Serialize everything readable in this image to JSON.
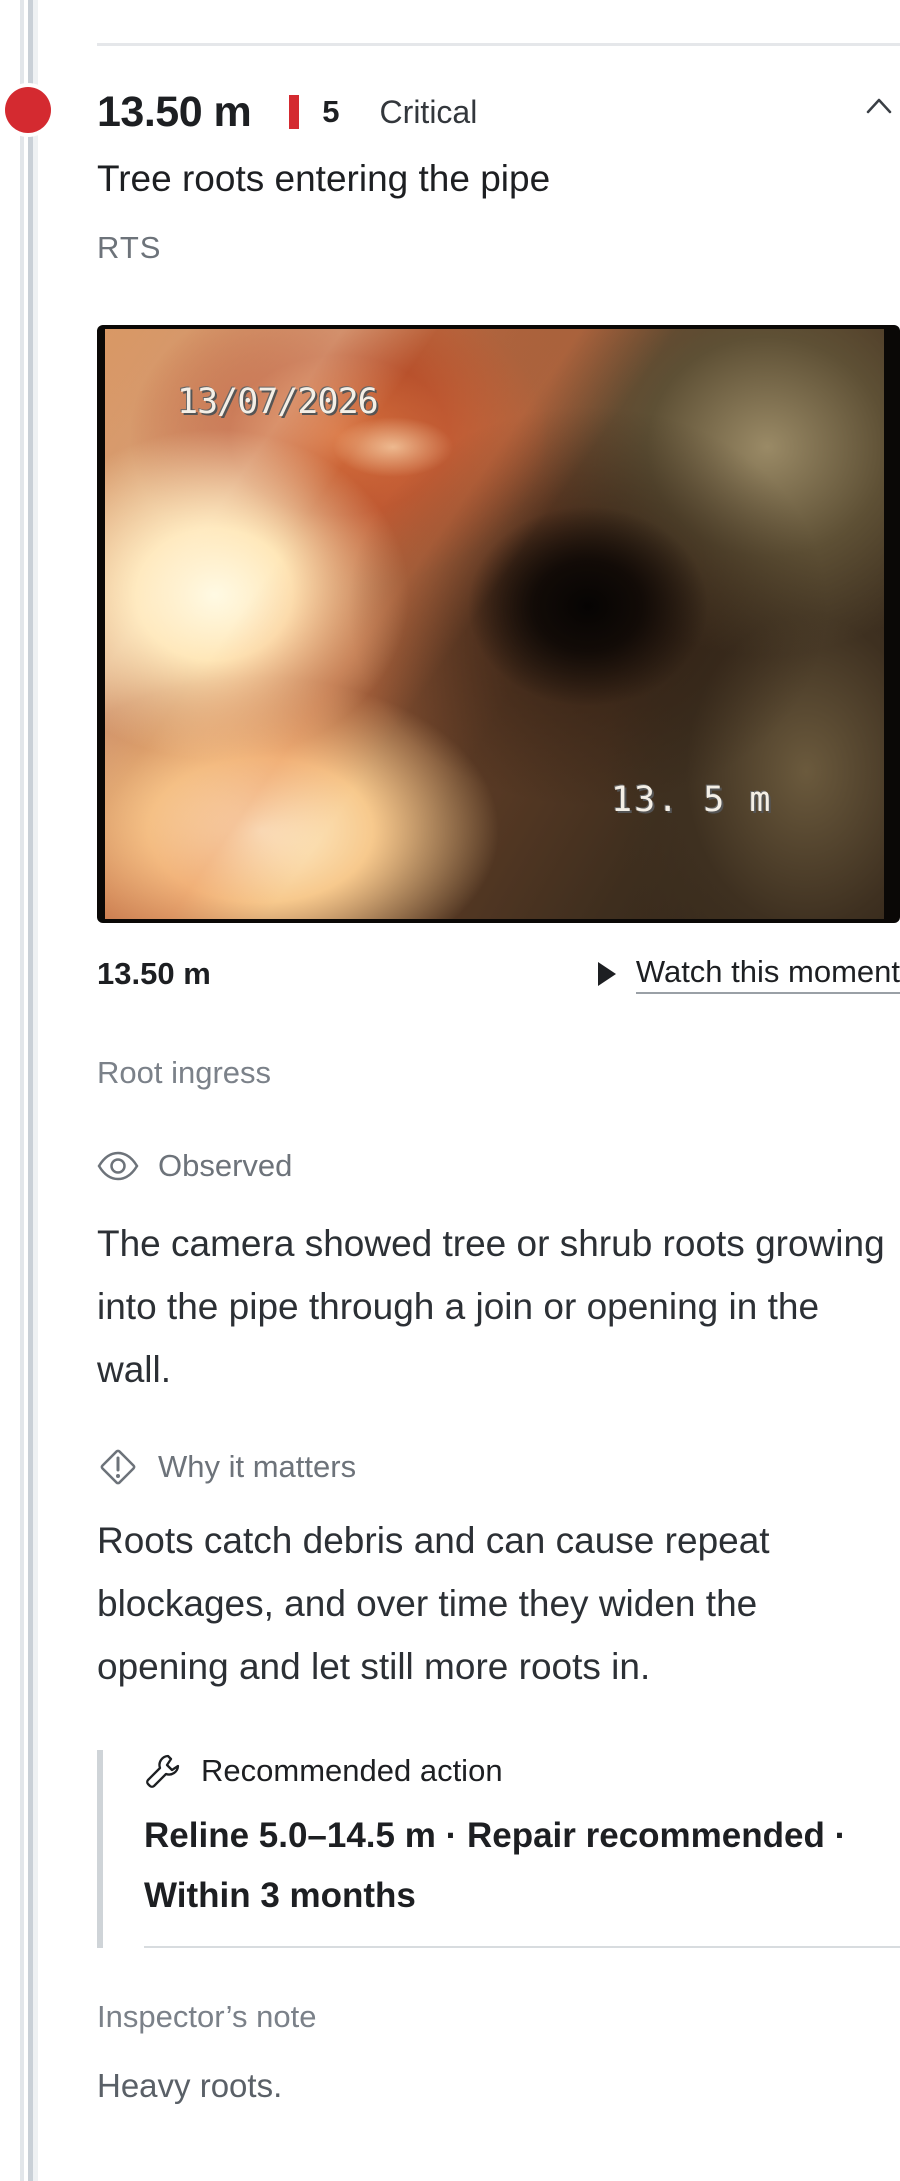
{
  "defect": {
    "distance": "13.50 m",
    "severity_number": "5",
    "severity_label": "Critical",
    "title": "Tree roots entering the pipe",
    "code": "RTS",
    "colors": {
      "severity": "#d42a30",
      "timeline": "#c9d0d7"
    }
  },
  "frame": {
    "osd_date": "13/07/2026",
    "osd_depth": "13. 5  m",
    "distance": "13.50 m",
    "watch_label": "Watch this moment",
    "watch_icon": "play-icon"
  },
  "details": {
    "category": "Root ingress",
    "observed_label": "Observed",
    "observed_icon": "eye-icon",
    "observed_text": "The camera showed tree or shrub roots growing into the pipe through a join or opening in the wall.",
    "why_label": "Why it matters",
    "why_icon": "warning-diamond-icon",
    "why_text": "Roots catch debris and can cause repeat blockages, and over time they widen the opening and let still more roots in.",
    "action_label": "Recommended action",
    "action_icon": "wrench-icon",
    "action_text": "Reline 5.0–14.5 m · Repair recommended · Within 3 months",
    "note_label": "Inspector’s note",
    "note_text": "Heavy roots."
  },
  "controls": {
    "collapse_icon": "chevron-up-icon"
  }
}
